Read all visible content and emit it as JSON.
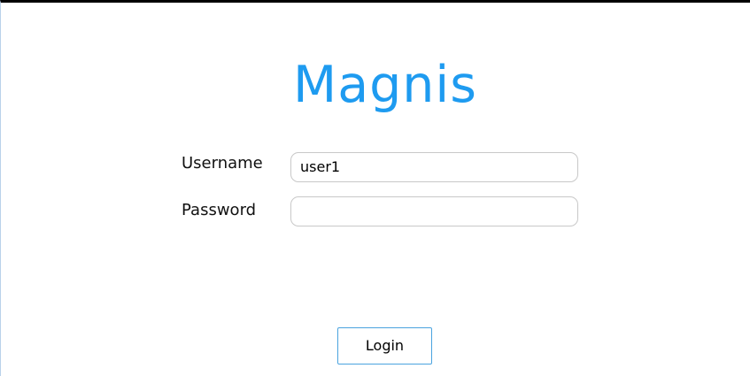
{
  "app": {
    "title": "Magnis"
  },
  "form": {
    "username_label": "Username",
    "username_value": "user1",
    "password_label": "Password",
    "password_value": "",
    "login_label": "Login"
  },
  "colors": {
    "title": "#1e9bf0",
    "button_border": "#4aa3df",
    "input_border": "#c8c8c8"
  }
}
